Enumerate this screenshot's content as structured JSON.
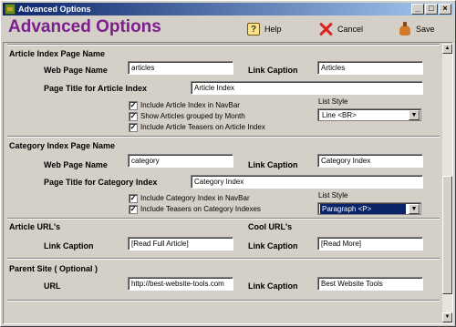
{
  "window": {
    "title": "Advanced Options"
  },
  "header": {
    "title": "Advanced Options",
    "help_label": "Help",
    "cancel_label": "Cancel",
    "save_label": "Save"
  },
  "article_index": {
    "section_title": "Article Index Page Name",
    "web_page_name_label": "Web Page Name",
    "web_page_name_value": "articles",
    "link_caption_label": "Link Caption",
    "link_caption_value": "Articles",
    "page_title_label": "Page Title for Article Index",
    "page_title_value": "Article Index",
    "checkboxes": [
      {
        "label": "Include Article Index in NavBar",
        "checked": true
      },
      {
        "label": "Show Articles grouped by Month",
        "checked": true
      },
      {
        "label": "Include Article Teasers on Article Index",
        "checked": true
      }
    ],
    "list_style_label": "List Style",
    "list_style_value": "Line <BR>"
  },
  "category_index": {
    "section_title": "Category Index Page Name",
    "web_page_name_label": "Web Page Name",
    "web_page_name_value": "category",
    "link_caption_label": "Link Caption",
    "link_caption_value": "Category Index",
    "page_title_label": "Page Title for Category Index",
    "page_title_value": "Category Index",
    "checkboxes": [
      {
        "label": "Include Category Index in NavBar",
        "checked": true
      },
      {
        "label": "Include Teasers on Category Indexes",
        "checked": true
      }
    ],
    "list_style_label": "List Style",
    "list_style_value": "Paragraph <P>"
  },
  "article_urls": {
    "section_title": "Article URL's",
    "link_caption_label": "Link Caption",
    "link_caption_value": "[Read Full Article]"
  },
  "cool_urls": {
    "section_title": "Cool URL's",
    "link_caption_label": "Link Caption",
    "link_caption_value": "[Read More]"
  },
  "parent_site": {
    "section_title": "Parent Site ( Optional )",
    "url_label": "URL",
    "url_value": "http://best-website-tools.com",
    "link_caption_label": "Link Caption",
    "link_caption_value": "Best Website Tools"
  },
  "glyphs": {
    "check": "✓",
    "down_arrow": "▼",
    "up_arrow": "▲",
    "help": "?",
    "minimize": "_",
    "maximize": "□",
    "close": "×"
  }
}
